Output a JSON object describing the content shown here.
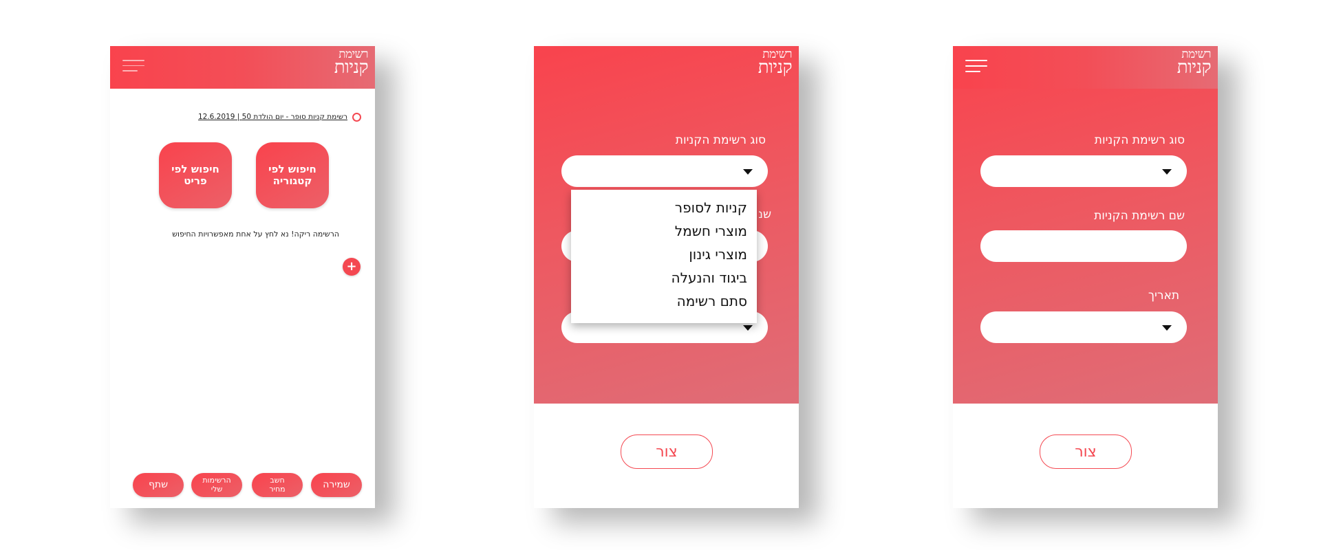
{
  "app": {
    "logo_line1": "רשימת",
    "logo_line2": "קניות"
  },
  "home": {
    "list_title": "רשימת קניות סופר - יום הולדת 50 | 12.6.2019",
    "search_by_category": "חיפוש לפי קטגוריה",
    "search_by_item": "חיפוש לפי פריט",
    "empty_message": "הרשימה ריקה! נא לחץ על אחת מאפשרויות החיפוש",
    "add_button": "+",
    "bottom_buttons": {
      "save": "שמירה",
      "calc_price": "חשב מחיר",
      "my_lists": "הרשימות שלי",
      "share": "שתף"
    }
  },
  "form": {
    "type_label": "סוג רשימת הקניות",
    "name_label": "שם רשימת הקניות",
    "date_label": "תאריך",
    "create_button": "צור",
    "dropdown_options": [
      "קניות לסופר",
      "מוצרי חשמל",
      "מוצרי גינון",
      "ביגוד והנעלה",
      "סתם רשימה"
    ]
  },
  "colors": {
    "accent": "#f44851",
    "accent_light": "#e0707a",
    "text": "#222222",
    "background": "#ffffff"
  },
  "icons": {
    "menu": "hamburger-icon",
    "caret": "caret-down-icon",
    "radio": "radio-icon",
    "add": "plus-icon"
  }
}
